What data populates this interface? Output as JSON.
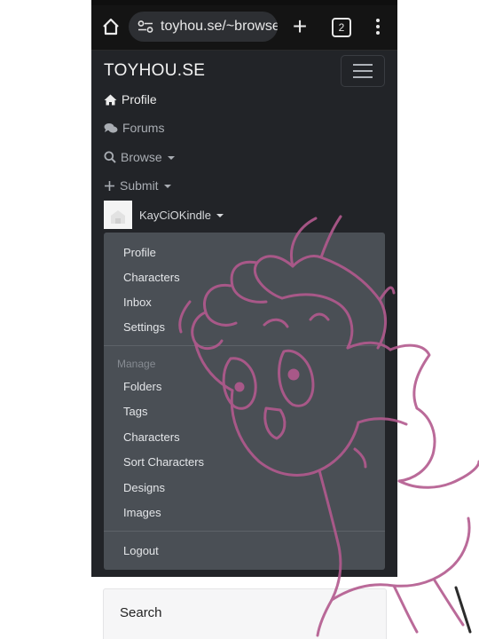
{
  "browser": {
    "url": "toyhou.se/~browse/s",
    "tab_count": "2",
    "icons": {
      "home": "home-icon",
      "site_info": "tune-icon",
      "new_tab": "plus-icon",
      "menu": "kebab-menu-icon"
    }
  },
  "site": {
    "brand": "TOYHOU.SE",
    "nav": {
      "profile": "Profile",
      "forums": "Forums",
      "browse": "Browse",
      "submit": "Submit",
      "username": "KayCiOKindle"
    },
    "dropdown": {
      "items_top": [
        "Profile",
        "Characters",
        "Inbox",
        "Settings"
      ],
      "manage_header": "Manage",
      "items_manage": [
        "Folders",
        "Tags",
        "Characters",
        "Sort Characters",
        "Designs",
        "Images"
      ],
      "logout": "Logout"
    },
    "search_title": "Search"
  },
  "colors": {
    "page_bg": "#222428",
    "dropdown_bg": "#4a4f55",
    "browser_bar": "#141414",
    "doodle_stroke": "#b35a8e"
  }
}
